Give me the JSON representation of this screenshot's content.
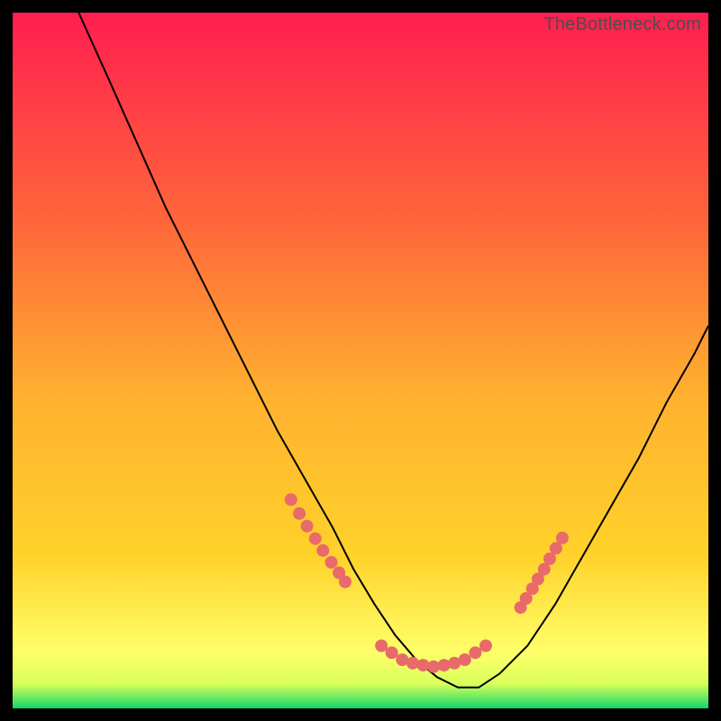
{
  "watermark": "TheBottleneck.com",
  "chart_data": {
    "type": "line",
    "title": "",
    "xlabel": "",
    "ylabel": "",
    "xlim": [
      0,
      100
    ],
    "ylim": [
      0,
      100
    ],
    "grid": false,
    "background_gradient": {
      "top_color": "#ff1e50",
      "mid_color": "#ffd22a",
      "bottom_color": "#12d66b"
    },
    "bottom_band_color": "#ffff7a",
    "bottom_band_range_y": [
      92,
      98
    ],
    "series": [
      {
        "name": "curve",
        "color": "#000000",
        "x": [
          9.5,
          14,
          18,
          22,
          26,
          30,
          34,
          38,
          42,
          46,
          49,
          52,
          55,
          58,
          61,
          64,
          67,
          70,
          74,
          78,
          82,
          86,
          90,
          94,
          98,
          100
        ],
        "y": [
          0,
          10,
          19,
          28,
          36,
          44,
          52,
          60,
          67,
          74,
          80,
          85,
          89.5,
          93,
          95.5,
          97,
          97,
          95,
          91,
          85,
          78,
          71,
          64,
          56,
          49,
          45
        ]
      }
    ],
    "marker_clusters": [
      {
        "name": "left-cluster",
        "color": "#e86a6a",
        "points": [
          {
            "x": 40.0,
            "y": 70.0
          },
          {
            "x": 41.2,
            "y": 72.0
          },
          {
            "x": 42.3,
            "y": 73.8
          },
          {
            "x": 43.5,
            "y": 75.6
          },
          {
            "x": 44.6,
            "y": 77.3
          },
          {
            "x": 45.8,
            "y": 79.0
          },
          {
            "x": 46.9,
            "y": 80.5
          },
          {
            "x": 47.8,
            "y": 81.8
          }
        ]
      },
      {
        "name": "bottom-cluster",
        "color": "#e86a6a",
        "points": [
          {
            "x": 53.0,
            "y": 91.0
          },
          {
            "x": 54.5,
            "y": 92.0
          },
          {
            "x": 56.0,
            "y": 93.0
          },
          {
            "x": 57.5,
            "y": 93.5
          },
          {
            "x": 59.0,
            "y": 93.8
          },
          {
            "x": 60.5,
            "y": 94.0
          },
          {
            "x": 62.0,
            "y": 93.8
          },
          {
            "x": 63.5,
            "y": 93.5
          },
          {
            "x": 65.0,
            "y": 93.0
          },
          {
            "x": 66.5,
            "y": 92.0
          },
          {
            "x": 68.0,
            "y": 91.0
          }
        ]
      },
      {
        "name": "right-cluster",
        "color": "#e86a6a",
        "points": [
          {
            "x": 73.0,
            "y": 85.5
          },
          {
            "x": 73.8,
            "y": 84.2
          },
          {
            "x": 74.7,
            "y": 82.8
          },
          {
            "x": 75.5,
            "y": 81.4
          },
          {
            "x": 76.4,
            "y": 80.0
          },
          {
            "x": 77.2,
            "y": 78.5
          },
          {
            "x": 78.1,
            "y": 77.0
          },
          {
            "x": 79.0,
            "y": 75.5
          }
        ]
      }
    ]
  }
}
